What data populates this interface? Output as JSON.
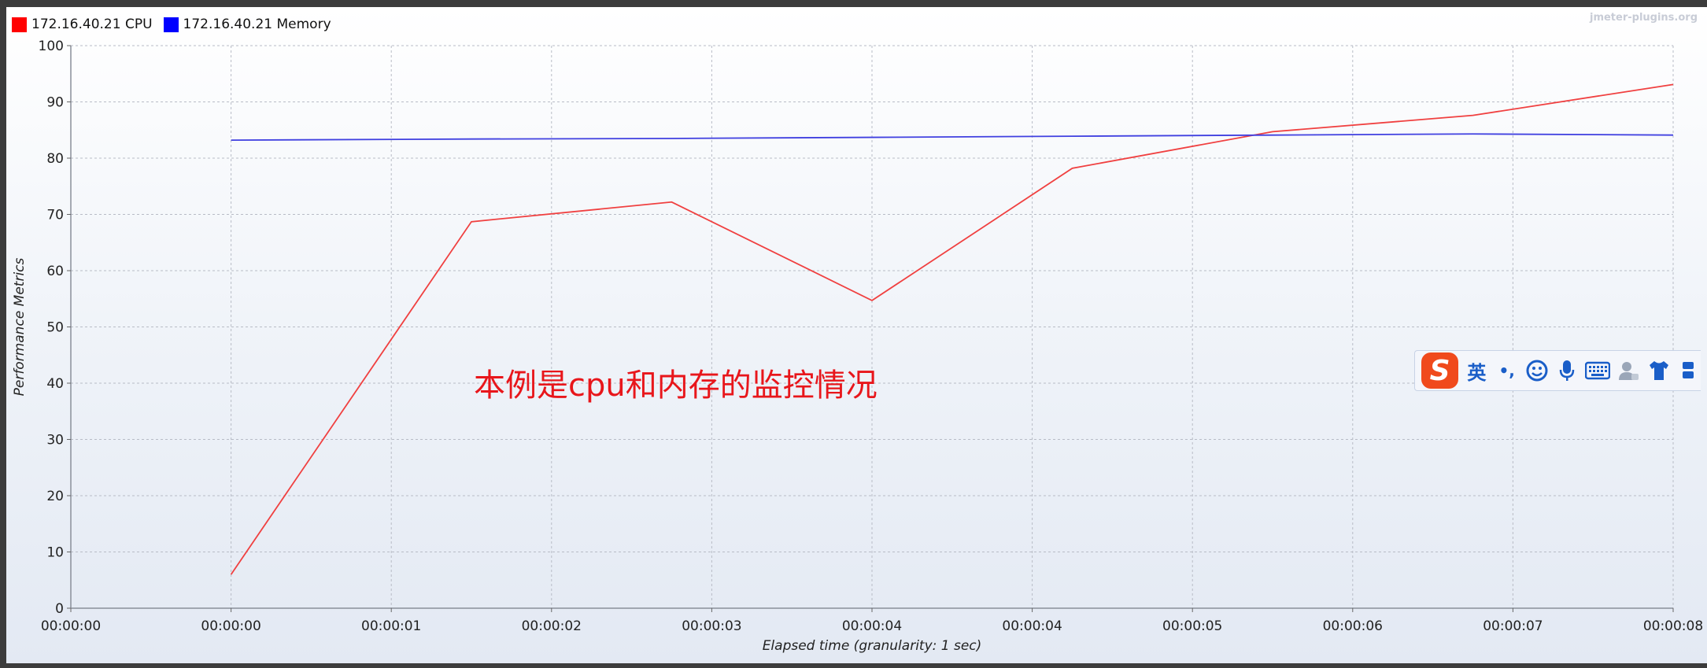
{
  "watermark": "jmeter-plugins.org",
  "annotation_text": "本例是cpu和内存的监控情况",
  "ime_toolbar": {
    "lang_label": "英",
    "punct_label": "•,",
    "icons": [
      "sogou-logo-icon",
      "smiley-icon",
      "microphone-icon",
      "keyboard-icon",
      "user-icon",
      "shirt-icon",
      "grid-icon"
    ]
  },
  "chart_data": {
    "type": "line",
    "title": "",
    "xlabel": "Elapsed time (granularity: 1 sec)",
    "ylabel": "Performance Metrics",
    "ylim": [
      0,
      100
    ],
    "xlim": [
      0,
      8
    ],
    "yticks": [
      0,
      10,
      20,
      30,
      40,
      50,
      60,
      70,
      80,
      90,
      100
    ],
    "xticks": [
      "00:00:00",
      "00:00:00",
      "00:00:01",
      "00:00:02",
      "00:00:03",
      "00:00:04",
      "00:00:04",
      "00:00:05",
      "00:00:06",
      "00:00:07",
      "00:00:08"
    ],
    "grid": true,
    "legend_position": "top-left",
    "series": [
      {
        "name": "172.16.40.21 CPU",
        "color": "#ff0000",
        "line_color": "#f04040",
        "x": [
          1.0,
          2.5,
          3.75,
          5.0,
          6.25,
          7.5,
          8.75,
          10.0
        ],
        "values": [
          6,
          68.7,
          72.2,
          54.7,
          78.2,
          84.7,
          87.6,
          93.1
        ]
      },
      {
        "name": "172.16.40.21 Memory",
        "color": "#0000ff",
        "line_color": "#4040e0",
        "x": [
          1.0,
          2.5,
          3.75,
          5.0,
          6.25,
          7.5,
          8.75,
          10.0
        ],
        "values": [
          83.2,
          83.4,
          83.5,
          83.7,
          83.9,
          84.1,
          84.3,
          84.1
        ]
      }
    ]
  }
}
